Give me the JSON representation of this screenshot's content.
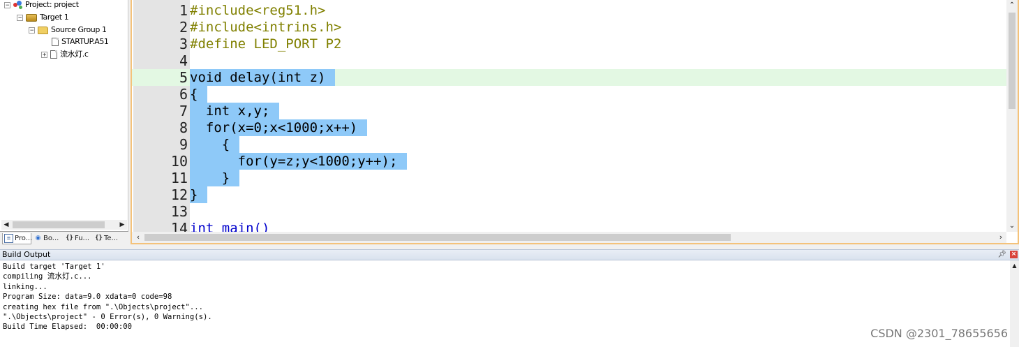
{
  "project_tree": {
    "items": [
      {
        "label": "Project: project"
      },
      {
        "label": "Target 1"
      },
      {
        "label": "Source Group 1"
      },
      {
        "label": "STARTUP.A51"
      },
      {
        "label": "流水灯.c"
      }
    ]
  },
  "project_tabs": [
    {
      "label": "Pro..."
    },
    {
      "label": "Bo..."
    },
    {
      "label": "Fu..."
    },
    {
      "label": "Te..."
    }
  ],
  "editor": {
    "lines": [
      {
        "num": "1",
        "pre": "#include",
        "code": "<reg51.h>"
      },
      {
        "num": "2",
        "pre": "#include",
        "code": "<intrins.h>"
      },
      {
        "num": "3",
        "pre": "#define",
        "code": " LED_PORT P2"
      },
      {
        "num": "4",
        "code": ""
      },
      {
        "num": "5",
        "code": "void delay(int z)"
      },
      {
        "num": "6",
        "code": "{"
      },
      {
        "num": "7",
        "code": "  int x,y;"
      },
      {
        "num": "8",
        "code": "  for(x=0;x<1000;x++)"
      },
      {
        "num": "9",
        "code": "    {"
      },
      {
        "num": "10",
        "code": "      for(y=z;y<1000;y++);"
      },
      {
        "num": "11",
        "code": "    }"
      },
      {
        "num": "12",
        "code": "}"
      },
      {
        "num": "13",
        "code": ""
      },
      {
        "num": "14",
        "code": "int main()"
      }
    ]
  },
  "build_output": {
    "title": "Build Output",
    "lines": [
      "Build target 'Target 1'",
      "compiling 流水灯.c...",
      "linking...",
      "Program Size: data=9.0 xdata=0 code=98",
      "creating hex file from \".\\Objects\\project\"...",
      "\".\\Objects\\project\" - 0 Error(s), 0 Warning(s).",
      "Build Time Elapsed:  00:00:00"
    ]
  },
  "watermark": "CSDN @2301_78655656",
  "colors": {
    "selection": "#8ec9f8",
    "current_line": "#e3f8e3",
    "preprocessor": "#808000",
    "editor_border": "#f4c27a"
  }
}
